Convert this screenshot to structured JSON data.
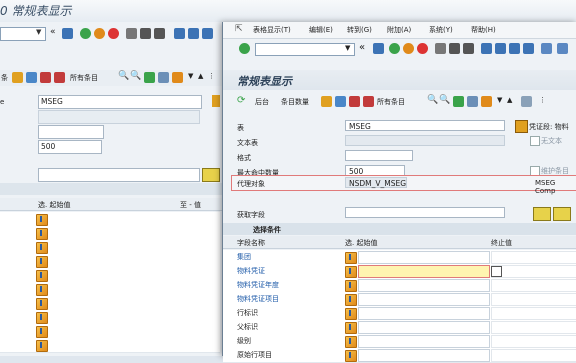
{
  "background_window": {
    "title": "0 常规表显示",
    "appbar_text": "所有条目",
    "field_label_left": "e",
    "table_value": "MSEG",
    "max_hits": "500",
    "col_from": "选. 起始值",
    "col_to": "至 - 值"
  },
  "menu": [
    "表格显示(T)",
    "编辑(E)",
    "转到(G)",
    "附加(A)",
    "系统(Y)",
    "帮助(H)"
  ],
  "title": "常规表显示",
  "appbar": {
    "back": "后台",
    "entries_count": "条目数量",
    "all_entries": "所有条目"
  },
  "form": {
    "table_label": "表",
    "table_value": "MSEG",
    "text_table_label": "文本表",
    "format_label": "格式",
    "max_hits_label": "最大命中数量",
    "max_hits_value": "500",
    "proxy_label": "代理对象",
    "proxy_value": "NSDM_V_MSEG",
    "proxy_desc": "MSEG Comp",
    "certificate_label": "凭证段: 物料",
    "no_text_label": "无文本",
    "maintain_label": "维护条目",
    "fetch_label": "获取字段"
  },
  "selection": {
    "header": "选择条件",
    "col_field": "字段名称",
    "col_from": "选. 起始值",
    "col_to": "终止值",
    "rows": [
      {
        "name": "集团",
        "link": true
      },
      {
        "name": "物料凭证",
        "link": true
      },
      {
        "name": "物料凭证年度",
        "link": true
      },
      {
        "name": "物料凭证项目",
        "link": true
      },
      {
        "name": "行标识",
        "link": false
      },
      {
        "name": "父标识",
        "link": false
      },
      {
        "name": "级别",
        "link": false
      },
      {
        "name": "原始行项目",
        "link": false
      }
    ]
  },
  "colors": {
    "accent": "#1d5aa8",
    "highlight_input": "#fff4b0",
    "proxy_border": "#e07a7a"
  }
}
